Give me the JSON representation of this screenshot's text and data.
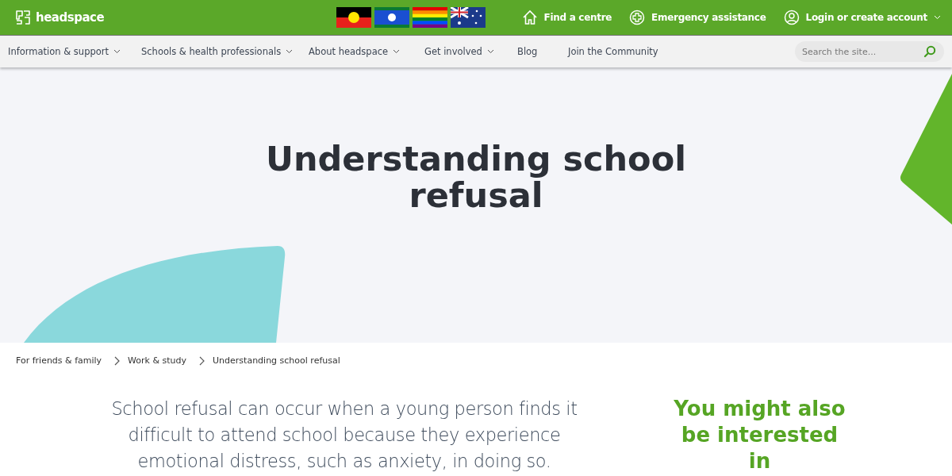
{
  "header": {
    "logo": "headspace",
    "links": [
      {
        "kind": "home",
        "label": "Find a centre",
        "dropdown": false
      },
      {
        "kind": "plus",
        "label": "Emergency assistance",
        "dropdown": false
      },
      {
        "kind": "user",
        "label": "Login or create account",
        "dropdown": true
      }
    ]
  },
  "nav": {
    "items": [
      {
        "label": "Information & support",
        "dropdown": true
      },
      {
        "label": "Schools & health professionals",
        "dropdown": true
      },
      {
        "label": "About headspace",
        "dropdown": true
      },
      {
        "label": "Get involved",
        "dropdown": true
      },
      {
        "label": "Blog",
        "dropdown": false
      },
      {
        "label": "Join the Community",
        "dropdown": false
      }
    ],
    "search": {
      "placeholder": "Search the site..."
    }
  },
  "hero": {
    "title": "Understanding school refusal"
  },
  "breadcrumbs": [
    "For friends & family",
    "Work & study",
    "Understanding school refusal"
  ],
  "intro": "School refusal can occur when a young person finds it difficult to attend school because they experience emotional distress, such as anxiety, in doing so.",
  "sidebar": {
    "heading": "You might also be interested in"
  }
}
